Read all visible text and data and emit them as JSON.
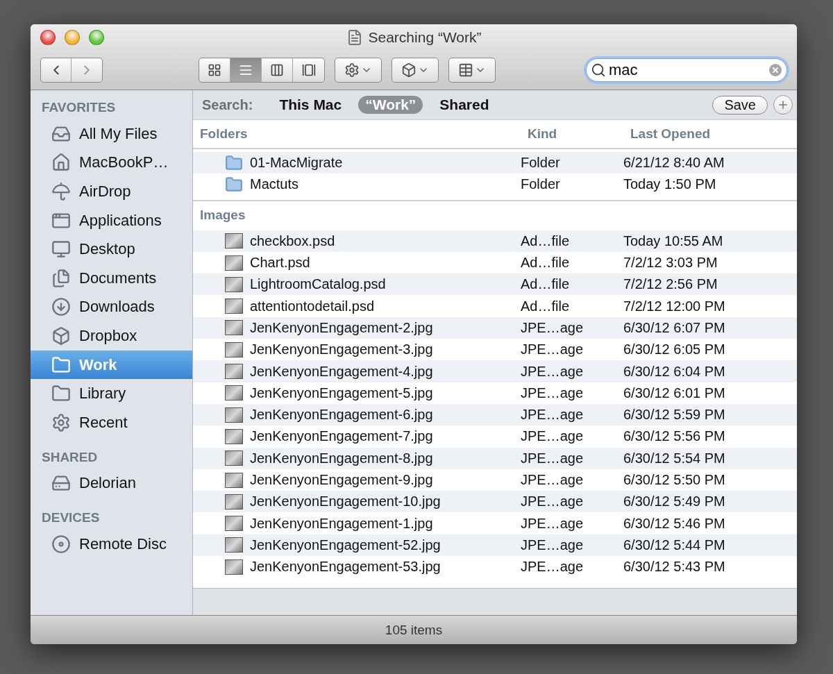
{
  "window": {
    "title": "Searching “Work”"
  },
  "toolbar": {
    "view_modes": [
      {
        "selected": false
      },
      {
        "selected": true
      },
      {
        "selected": false
      },
      {
        "selected": false
      }
    ],
    "search": {
      "value": "mac"
    }
  },
  "sidebar": {
    "sections": [
      {
        "title": "FAVORITES",
        "items": [
          {
            "label": "All My Files",
            "selected": false
          },
          {
            "label": "MacBookP…",
            "selected": false
          },
          {
            "label": "AirDrop",
            "selected": false
          },
          {
            "label": "Applications",
            "selected": false
          },
          {
            "label": "Desktop",
            "selected": false
          },
          {
            "label": "Documents",
            "selected": false
          },
          {
            "label": "Downloads",
            "selected": false
          },
          {
            "label": "Dropbox",
            "selected": false
          },
          {
            "label": "Work",
            "selected": true
          },
          {
            "label": "Library",
            "selected": false
          },
          {
            "label": "Recent",
            "selected": false
          }
        ]
      },
      {
        "title": "SHARED",
        "items": [
          {
            "label": "Delorian",
            "selected": false
          }
        ]
      },
      {
        "title": "DEVICES",
        "items": [
          {
            "label": "Remote Disc",
            "selected": false
          }
        ]
      }
    ]
  },
  "scope_bar": {
    "label": "Search:",
    "scopes": [
      {
        "label": "This Mac",
        "selected": false
      },
      {
        "label": "“Work”",
        "selected": true
      },
      {
        "label": "Shared",
        "selected": false
      }
    ],
    "save": "Save"
  },
  "table": {
    "columns": [
      "Kind",
      "Last Opened"
    ],
    "groups": [
      {
        "title": "Folders",
        "kind": "folder",
        "rows": [
          {
            "name": "01-MacMigrate",
            "kind": "Folder",
            "last_opened": "6/21/12 8:40 AM"
          },
          {
            "name": "Mactuts",
            "kind": "Folder",
            "last_opened": "Today 1:50 PM"
          }
        ]
      },
      {
        "title": "Images",
        "kind": "image",
        "rows": [
          {
            "name": "checkbox.psd",
            "kind": "Ad…file",
            "last_opened": "Today 10:55 AM"
          },
          {
            "name": "Chart.psd",
            "kind": "Ad…file",
            "last_opened": "7/2/12 3:03 PM"
          },
          {
            "name": "LightroomCatalog.psd",
            "kind": "Ad…file",
            "last_opened": "7/2/12 2:56 PM"
          },
          {
            "name": "attentiontodetail.psd",
            "kind": "Ad…file",
            "last_opened": "7/2/12 12:00 PM"
          },
          {
            "name": "JenKenyonEngagement-2.jpg",
            "kind": "JPE…age",
            "last_opened": "6/30/12 6:07 PM"
          },
          {
            "name": "JenKenyonEngagement-3.jpg",
            "kind": "JPE…age",
            "last_opened": "6/30/12 6:05 PM"
          },
          {
            "name": "JenKenyonEngagement-4.jpg",
            "kind": "JPE…age",
            "last_opened": "6/30/12 6:04 PM"
          },
          {
            "name": "JenKenyonEngagement-5.jpg",
            "kind": "JPE…age",
            "last_opened": "6/30/12 6:01 PM"
          },
          {
            "name": "JenKenyonEngagement-6.jpg",
            "kind": "JPE…age",
            "last_opened": "6/30/12 5:59 PM"
          },
          {
            "name": "JenKenyonEngagement-7.jpg",
            "kind": "JPE…age",
            "last_opened": "6/30/12 5:56 PM"
          },
          {
            "name": "JenKenyonEngagement-8.jpg",
            "kind": "JPE…age",
            "last_opened": "6/30/12 5:54 PM"
          },
          {
            "name": "JenKenyonEngagement-9.jpg",
            "kind": "JPE…age",
            "last_opened": "6/30/12 5:50 PM"
          },
          {
            "name": "JenKenyonEngagement-10.jpg",
            "kind": "JPE…age",
            "last_opened": "6/30/12 5:49 PM"
          },
          {
            "name": "JenKenyonEngagement-1.jpg",
            "kind": "JPE…age",
            "last_opened": "6/30/12 5:46 PM"
          },
          {
            "name": "JenKenyonEngagement-52.jpg",
            "kind": "JPE…age",
            "last_opened": "6/30/12 5:44 PM"
          },
          {
            "name": "JenKenyonEngagement-53.jpg",
            "kind": "JPE…age",
            "last_opened": "6/30/12 5:43 PM"
          }
        ]
      }
    ]
  },
  "status_bar": {
    "text": "105 items"
  }
}
